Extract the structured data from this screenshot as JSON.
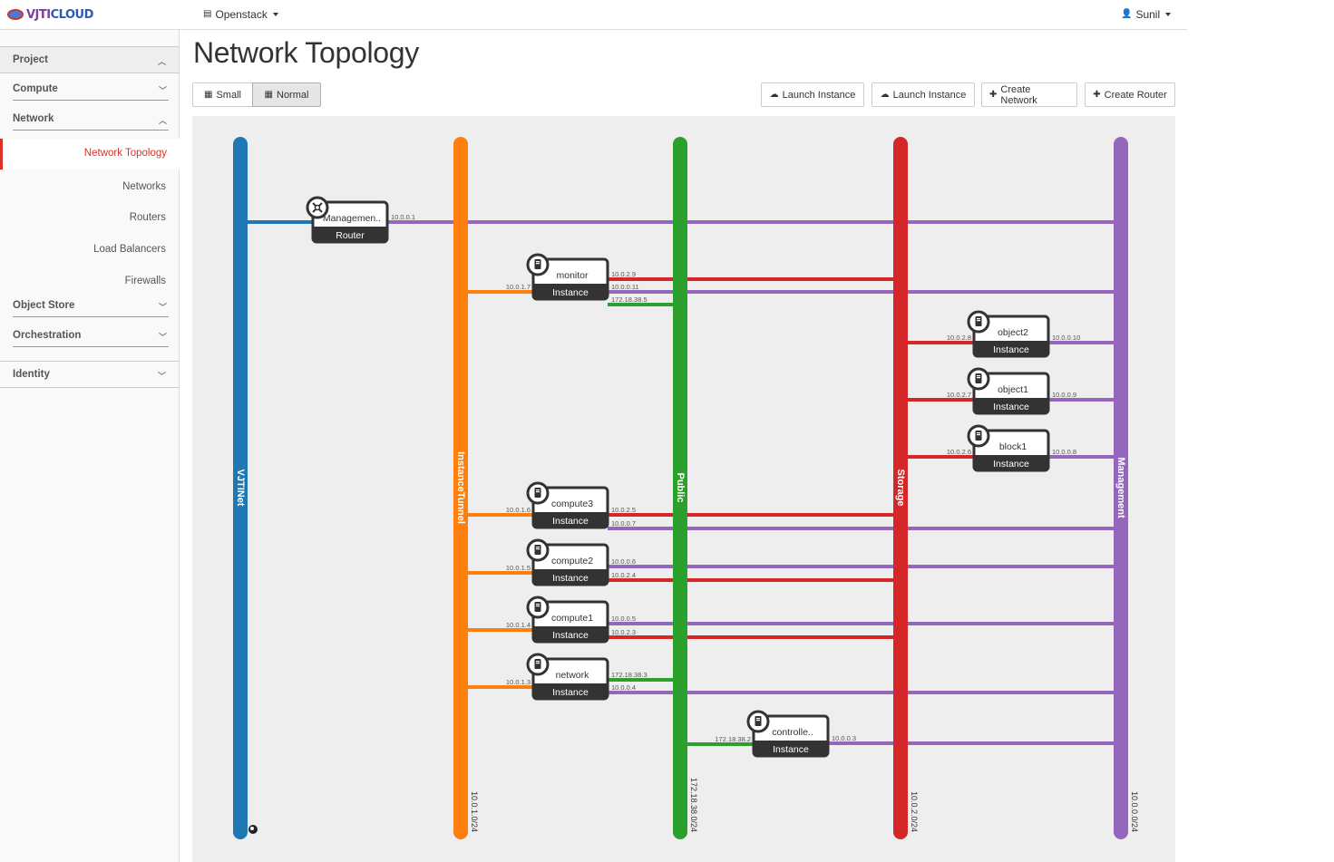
{
  "brand": {
    "text_a": "VJTI",
    "text_b": "CLOUD"
  },
  "topbar": {
    "project_menu": "Openstack",
    "user_menu": "Sunil"
  },
  "sidebar": {
    "project": "Project",
    "compute": "Compute",
    "network": "Network",
    "network_items": [
      "Network Topology",
      "Networks",
      "Routers",
      "Load Balancers",
      "Firewalls"
    ],
    "object_store": "Object Store",
    "orchestration": "Orchestration",
    "identity": "Identity"
  },
  "main": {
    "title": "Network Topology",
    "view_small": "Small",
    "view_normal": "Normal",
    "actions": [
      "Launch Instance",
      "Launch Instance",
      "Create Network",
      "Create Router"
    ]
  },
  "topology": {
    "networks": [
      {
        "name": "VJTINet",
        "cidr": "",
        "color": "#1f77b4"
      },
      {
        "name": "InstanceTunnel",
        "cidr": "10.0.1.0/24",
        "color": "#ff7f0e"
      },
      {
        "name": "Public",
        "cidr": "172.18.38.0/24",
        "color": "#2ca02c"
      },
      {
        "name": "Storage",
        "cidr": "10.0.2.0/24",
        "color": "#d62728"
      },
      {
        "name": "Management",
        "cidr": "10.0.0.0/24",
        "color": "#9467bd"
      }
    ],
    "devices": [
      {
        "name": "Managemen..",
        "type": "Router",
        "icon": "router-icon",
        "links": [
          {
            "net": "VJTINet",
            "ip": ""
          },
          {
            "net": "Management",
            "ip": "10.0.0.1"
          }
        ]
      },
      {
        "name": "monitor",
        "type": "Instance",
        "icon": "server-icon",
        "links": [
          {
            "net": "InstanceTunnel",
            "ip": "10.0.1.7"
          },
          {
            "net": "Storage",
            "ip": "10.0.2.9"
          },
          {
            "net": "Management",
            "ip": "10.0.0.11"
          },
          {
            "net": "Public",
            "ip": "172.18.38.5"
          }
        ]
      },
      {
        "name": "object2",
        "type": "Instance",
        "icon": "server-icon",
        "links": [
          {
            "net": "Storage",
            "ip": "10.0.2.8"
          },
          {
            "net": "Management",
            "ip": "10.0.0.10"
          }
        ]
      },
      {
        "name": "object1",
        "type": "Instance",
        "icon": "server-icon",
        "links": [
          {
            "net": "Storage",
            "ip": "10.0.2.7"
          },
          {
            "net": "Management",
            "ip": "10.0.0.9"
          }
        ]
      },
      {
        "name": "block1",
        "type": "Instance",
        "icon": "server-icon",
        "links": [
          {
            "net": "Storage",
            "ip": "10.0.2.6"
          },
          {
            "net": "Management",
            "ip": "10.0.0.8"
          }
        ]
      },
      {
        "name": "compute3",
        "type": "Instance",
        "icon": "server-icon",
        "links": [
          {
            "net": "InstanceTunnel",
            "ip": "10.0.1.6"
          },
          {
            "net": "Storage",
            "ip": "10.0.2.5"
          },
          {
            "net": "Management",
            "ip": "10.0.0.7"
          }
        ]
      },
      {
        "name": "compute2",
        "type": "Instance",
        "icon": "server-icon",
        "links": [
          {
            "net": "InstanceTunnel",
            "ip": "10.0.1.5"
          },
          {
            "net": "Management",
            "ip": "10.0.0.6"
          },
          {
            "net": "Storage",
            "ip": "10.0.2.4"
          }
        ]
      },
      {
        "name": "compute1",
        "type": "Instance",
        "icon": "server-icon",
        "links": [
          {
            "net": "InstanceTunnel",
            "ip": "10.0.1.4"
          },
          {
            "net": "Management",
            "ip": "10.0.0.5"
          },
          {
            "net": "Storage",
            "ip": "10.0.2.3"
          }
        ]
      },
      {
        "name": "network",
        "type": "Instance",
        "icon": "server-icon",
        "links": [
          {
            "net": "InstanceTunnel",
            "ip": "10.0.1.3"
          },
          {
            "net": "Public",
            "ip": "172.18.38.3"
          },
          {
            "net": "Management",
            "ip": "10.0.0.4"
          }
        ]
      },
      {
        "name": "controlle..",
        "type": "Instance",
        "icon": "server-icon",
        "links": [
          {
            "net": "Public",
            "ip": "172.18.38.2"
          },
          {
            "net": "Management",
            "ip": "10.0.0.3"
          }
        ]
      }
    ]
  }
}
